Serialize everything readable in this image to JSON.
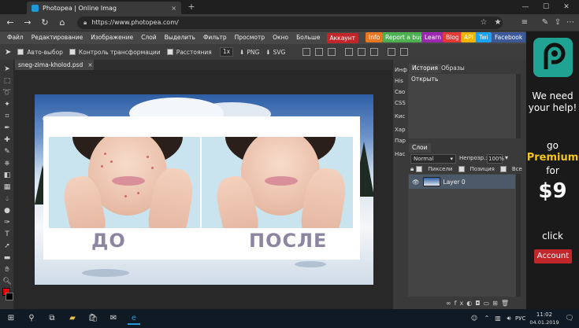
{
  "browser": {
    "tab_title": "Photopea | Online Imag",
    "tab_close": "×",
    "new_tab": "+",
    "url": "https://www.photopea.com/",
    "win_minimize": "—",
    "win_maximize": "☐",
    "win_close": "✕"
  },
  "menu": {
    "items": [
      "Файл",
      "Редактирование",
      "Изображение",
      "Слой",
      "Выделить",
      "Фильтр",
      "Просмотр",
      "Окно",
      "Больше"
    ],
    "account": "Аккаунт",
    "pills": [
      {
        "label": "Info",
        "color": "#e87722"
      },
      {
        "label": "Report a bug",
        "color": "#4caf50"
      },
      {
        "label": "Learn",
        "color": "#9c27b0"
      },
      {
        "label": "Blog",
        "color": "#e53935"
      },
      {
        "label": "API",
        "color": "#f0b400"
      },
      {
        "label": "Twi",
        "color": "#1da1f2"
      },
      {
        "label": "Facebook",
        "color": "#3b5998"
      }
    ]
  },
  "options": {
    "auto_select": "Авто-выбор",
    "transform_controls": "Контроль трансформации",
    "distances": "Расстояния",
    "zoom": "1x",
    "export_png": "PNG",
    "export_svg": "SVG"
  },
  "document": {
    "tab_name": "sneg-zima-kholod.psd",
    "tab_close": "×",
    "before_label": "ДО",
    "after_label": "ПОСЛЕ"
  },
  "collapsed_panels": [
    "Инф",
    "His",
    "Сво",
    "CSS",
    "Кис",
    "Хар",
    "Пар",
    "Нас"
  ],
  "history_panel": {
    "tabs": [
      "История",
      "Образы"
    ],
    "entries": [
      "Открыть"
    ]
  },
  "layers_panel": {
    "title": "Слои",
    "blend_mode": "Normal",
    "opacity_label": "Непрозр.:",
    "opacity_value": "100%",
    "lock_pixels": "Пиксели",
    "lock_position": "Позиция",
    "lock_all": "Все",
    "layers": [
      "Layer 0"
    ]
  },
  "ad": {
    "line1": "We need",
    "line2": "your help!",
    "line3": "go",
    "line4": "Premium",
    "line5": "for",
    "price": "$9",
    "line6": "click",
    "button": "Account"
  },
  "taskbar": {
    "time": "11:02",
    "date": "04.01.2019",
    "lang": "РУС"
  }
}
